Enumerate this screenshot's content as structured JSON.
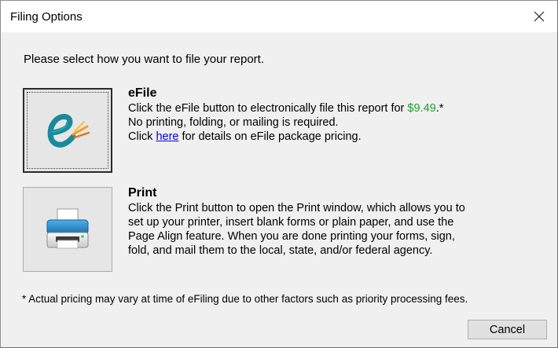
{
  "window": {
    "title": "Filing Options"
  },
  "prompt": "Please select how you want to file your report.",
  "efile": {
    "title": "eFile",
    "line1_prefix": "Click the eFile button to electronically file this report for ",
    "price": "$9.49",
    "line1_suffix": ".*",
    "line2": "No printing, folding, or mailing is required.",
    "line3_prefix": "Click ",
    "link": "here",
    "line3_suffix": " for details on eFile package pricing."
  },
  "print": {
    "title": "Print",
    "line1": "Click the Print button to open the Print window, which allows you to",
    "line2": "set up your printer, insert blank forms or plain paper, and use the",
    "line3": "Page Align feature. When you are done printing your forms, sign,",
    "line4": "fold, and mail them to the local, state, and/or federal agency."
  },
  "footnote": "* Actual pricing may vary at time of eFiling due to other factors such as priority processing fees.",
  "buttons": {
    "cancel": "Cancel"
  },
  "colors": {
    "price": "#1f9e2c",
    "link": "#0000ee",
    "efile_icon": "#1a8a9a",
    "efile_spark": "#f0a020",
    "printer_accent": "#1f86c8"
  },
  "icons": {
    "efile_button": "efile-logo-icon",
    "print_button": "printer-icon",
    "close": "close-icon"
  }
}
